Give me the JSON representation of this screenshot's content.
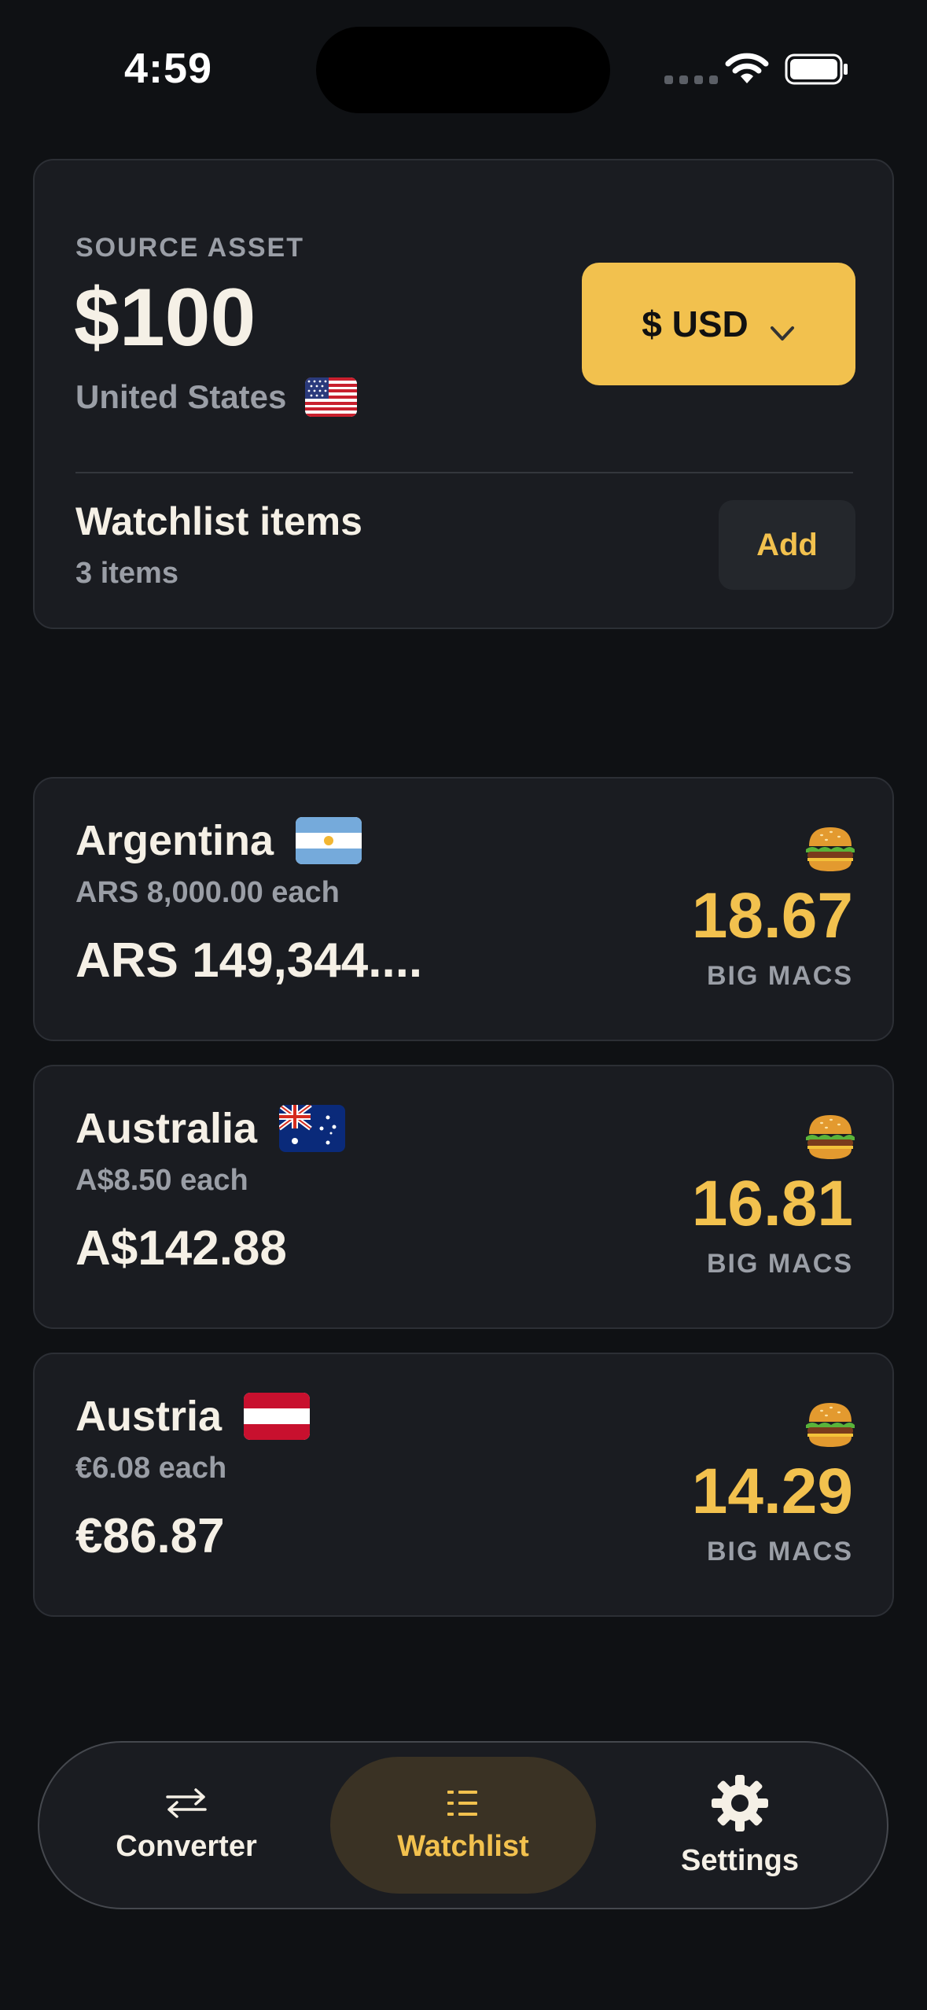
{
  "status_bar": {
    "time": "4:59"
  },
  "source": {
    "eyebrow": "SOURCE ASSET",
    "amount": "$100",
    "country": "United States",
    "currency_button": "$ USD",
    "watchlist_title": "Watchlist items",
    "watchlist_count": "3 items",
    "add_label": "Add"
  },
  "items": [
    {
      "country": "Argentina",
      "each": "ARS 8,000.00 each",
      "total": "ARS 149,344....",
      "big_macs": "18.67",
      "unit": "BIG MACS"
    },
    {
      "country": "Australia",
      "each": "A$8.50 each",
      "total": "A$142.88",
      "big_macs": "16.81",
      "unit": "BIG MACS"
    },
    {
      "country": "Austria",
      "each": "€6.08 each",
      "total": "€86.87",
      "big_macs": "14.29",
      "unit": "BIG MACS"
    }
  ],
  "tabs": [
    {
      "label": "Converter",
      "icon": "arrows-swap-icon",
      "active": false
    },
    {
      "label": "Watchlist",
      "icon": "list-icon",
      "active": true
    },
    {
      "label": "Settings",
      "icon": "gear-icon",
      "active": false
    }
  ],
  "colors": {
    "accent": "#f2c14e",
    "background": "#0f1114",
    "card": "#1a1c21"
  }
}
